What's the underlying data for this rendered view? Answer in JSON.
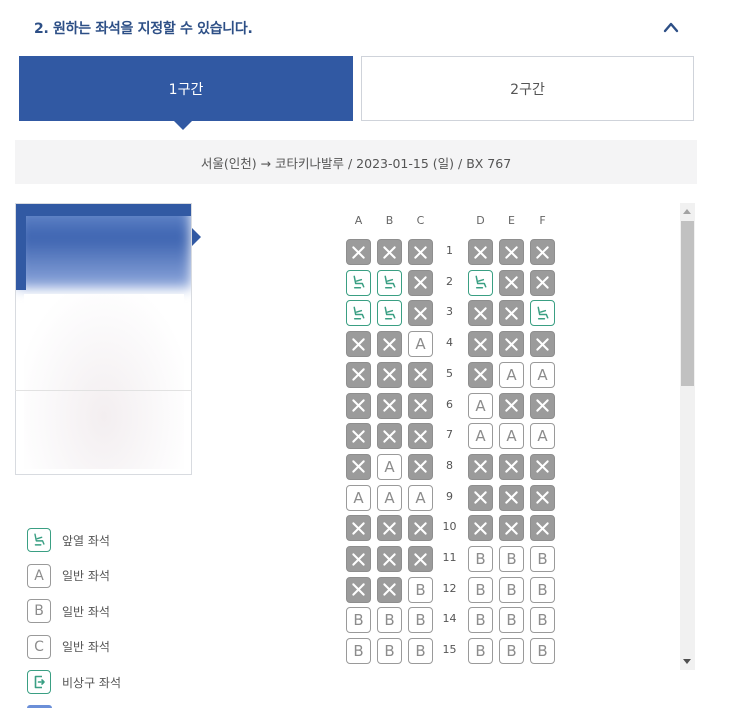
{
  "section": {
    "title": "2. 원하는 좌석을 지정할 수 있습니다."
  },
  "tabs": [
    {
      "label": "1구간",
      "active": true
    },
    {
      "label": "2구간",
      "active": false
    }
  ],
  "route": {
    "text": "서울(인천) → 코타키나발루 / 2023-01-15 (일) / BX 767"
  },
  "seatmap": {
    "left_columns": [
      "A",
      "B",
      "C"
    ],
    "right_columns": [
      "D",
      "E",
      "F"
    ],
    "rows": [
      {
        "num": "1",
        "seats": [
          "x",
          "x",
          "x",
          "x",
          "x",
          "x"
        ]
      },
      {
        "num": "2",
        "seats": [
          "f",
          "f",
          "x",
          "f",
          "x",
          "x"
        ]
      },
      {
        "num": "3",
        "seats": [
          "f",
          "f",
          "x",
          "x",
          "x",
          "f"
        ]
      },
      {
        "num": "4",
        "seats": [
          "x",
          "x",
          "A",
          "x",
          "x",
          "x"
        ]
      },
      {
        "num": "5",
        "seats": [
          "x",
          "x",
          "x",
          "x",
          "A",
          "A"
        ]
      },
      {
        "num": "6",
        "seats": [
          "x",
          "x",
          "x",
          "A",
          "x",
          "x"
        ]
      },
      {
        "num": "7",
        "seats": [
          "x",
          "x",
          "x",
          "A",
          "A",
          "A"
        ]
      },
      {
        "num": "8",
        "seats": [
          "x",
          "A",
          "x",
          "x",
          "x",
          "x"
        ]
      },
      {
        "num": "9",
        "seats": [
          "A",
          "A",
          "A",
          "x",
          "x",
          "x"
        ]
      },
      {
        "num": "10",
        "seats": [
          "x",
          "x",
          "x",
          "x",
          "x",
          "x"
        ]
      },
      {
        "num": "11",
        "seats": [
          "x",
          "x",
          "x",
          "B",
          "B",
          "B"
        ]
      },
      {
        "num": "12",
        "seats": [
          "x",
          "x",
          "B",
          "B",
          "B",
          "B"
        ]
      },
      {
        "num": "14",
        "seats": [
          "B",
          "B",
          "B",
          "B",
          "B",
          "B"
        ]
      },
      {
        "num": "15",
        "seats": [
          "B",
          "B",
          "B",
          "B",
          "B",
          "B"
        ]
      }
    ]
  },
  "legend": [
    {
      "type": "front",
      "icon": "front-row-seat-icon",
      "label": "앞열 좌석"
    },
    {
      "type": "plain",
      "letter": "A",
      "label": "일반 좌석"
    },
    {
      "type": "plain",
      "letter": "B",
      "label": "일반 좌석"
    },
    {
      "type": "plain",
      "letter": "C",
      "label": "일반 좌석"
    },
    {
      "type": "exit",
      "icon": "emergency-exit-icon",
      "label": "비상구 좌석"
    }
  ],
  "colors": {
    "brand": "#3159a3",
    "front_seat": "#3a9f83",
    "occupied": "#9b9b9b"
  }
}
